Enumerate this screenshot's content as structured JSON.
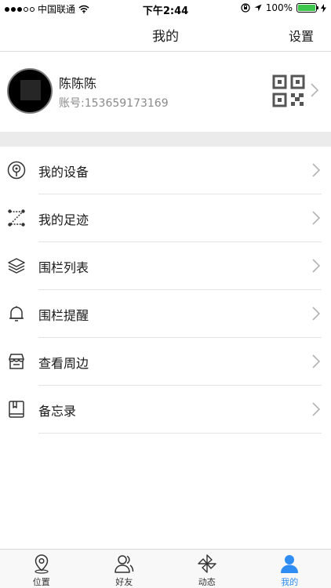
{
  "status_bar": {
    "carrier": "中国联通",
    "time": "下午2:44",
    "battery": "100%",
    "battery_level": 1.0
  },
  "nav": {
    "title": "我的",
    "settings_label": "设置"
  },
  "profile": {
    "name": "陈陈陈",
    "account": "账号:153659173169"
  },
  "menu": [
    {
      "label": "我的设备",
      "icon": "device-icon"
    },
    {
      "label": "我的足迹",
      "icon": "footprint-icon"
    },
    {
      "label": "围栏列表",
      "icon": "layers-icon"
    },
    {
      "label": "围栏提醒",
      "icon": "bell-icon"
    },
    {
      "label": "查看周边",
      "icon": "shop-icon"
    },
    {
      "label": "备忘录",
      "icon": "notebook-icon"
    }
  ],
  "tabs": [
    {
      "label": "位置",
      "icon": "location-icon",
      "active": false
    },
    {
      "label": "好友",
      "icon": "friends-icon",
      "active": false
    },
    {
      "label": "动态",
      "icon": "pinwheel-icon",
      "active": false
    },
    {
      "label": "我的",
      "icon": "person-icon",
      "active": true
    }
  ],
  "colors": {
    "accent": "#2f8cf2",
    "battery": "#3cc64b",
    "separator_band": "#ebebeb"
  }
}
